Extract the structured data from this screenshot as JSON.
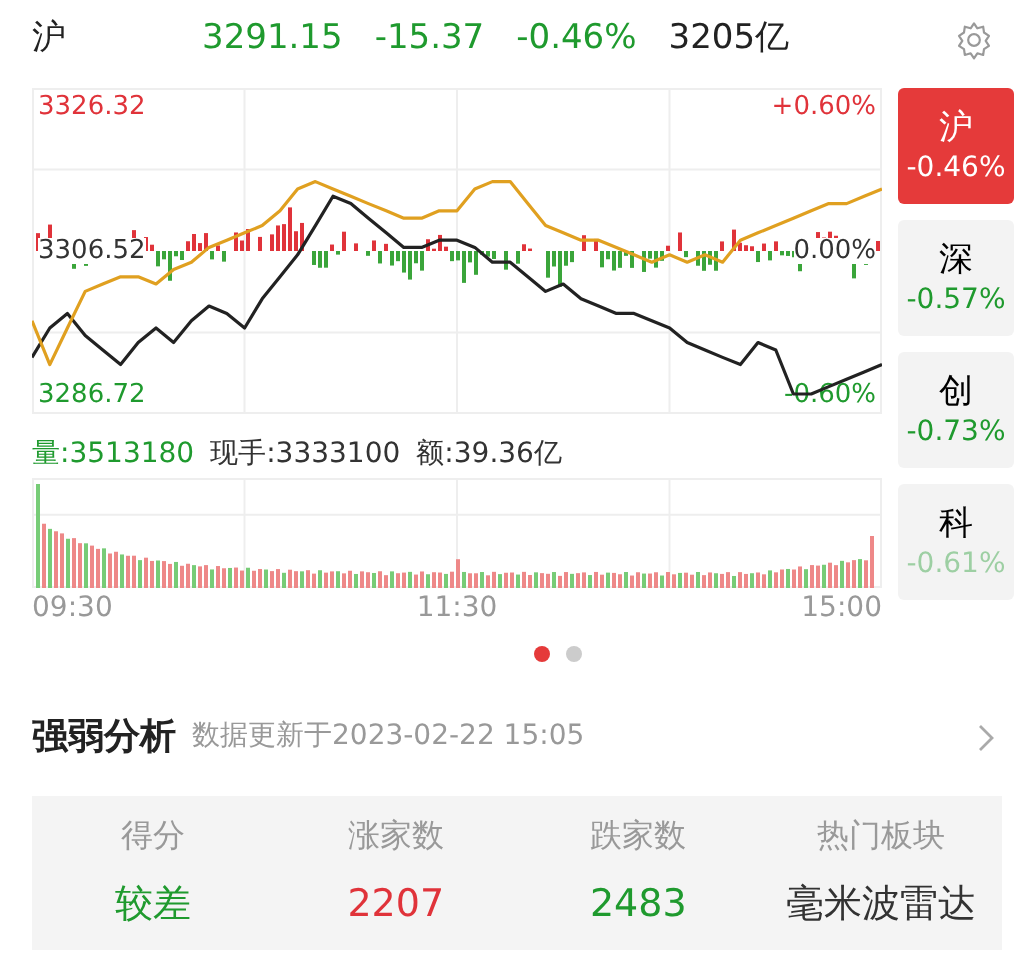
{
  "header": {
    "index_name": "沪",
    "price": "3291.15",
    "change": "-15.37",
    "change_percent": "-0.46%",
    "turnover": "3205亿"
  },
  "chart": {
    "top_percent": "+0.60%",
    "mid_percent": "0.00%",
    "bottom_percent": "-0.60%",
    "chart_data": {
      "type": "line",
      "categories": [
        null,
        null,
        null,
        null,
        null,
        null,
        null,
        null,
        null,
        null,
        null,
        null,
        null,
        null,
        null,
        null,
        null,
        null,
        null,
        null,
        null,
        null,
        null,
        null,
        null,
        null,
        null,
        null,
        null,
        null,
        null,
        null,
        null,
        null,
        null,
        null,
        null,
        null,
        null,
        null,
        null,
        null,
        null,
        null,
        null,
        null,
        null,
        null,
        null
      ],
      "series": [
        {
          "color": "#222222",
          "values": [
            3292,
            3296,
            3298,
            3295,
            3293,
            3291,
            3294,
            3296,
            3294,
            3297,
            3299,
            3298,
            3296,
            3300,
            3303,
            3306,
            3310,
            3314,
            3313,
            3311,
            3309,
            3307,
            3307,
            3308,
            3308,
            3307,
            3305,
            3305,
            3303,
            3301,
            3302,
            3300,
            3299,
            3298,
            3298,
            3297,
            3296,
            3294,
            3293,
            3292,
            3291,
            3294,
            3293,
            3287,
            3287,
            3288,
            3289,
            3290,
            3291
          ]
        },
        {
          "color": "#e0a020",
          "values": [
            3297,
            3291,
            3296,
            3301,
            3302,
            3303,
            3303,
            3302,
            3304,
            3305,
            3307,
            3308,
            3309,
            3310,
            3312,
            3315,
            3316,
            3315,
            3314,
            3313,
            3312,
            3311,
            3311,
            3312,
            3312,
            3315,
            3316,
            3316,
            3313,
            3310,
            3309,
            3308,
            3308,
            3307,
            3306,
            3305,
            3306,
            3305,
            3306,
            3305,
            3308,
            3309,
            3310,
            3311,
            3312,
            3313,
            3313,
            3314,
            3315
          ]
        }
      ],
      "ylim": [
        3284.26,
        3328.78
      ],
      "yticks": [
        {
          "value": 3326.32,
          "label": "3326.32"
        },
        {
          "value": 3306.52,
          "label": "3306.52"
        },
        {
          "value": 3286.72,
          "label": "3286.72"
        }
      ]
    }
  },
  "volume_info": [
    {
      "text": "量:3513180",
      "color": "#1f9a2e"
    },
    {
      "text": "现手:3333100",
      "color": "#333333"
    },
    {
      "text": "额:39.36亿",
      "color": "#333333"
    }
  ],
  "time_axis": [
    "09:30",
    "11:30",
    "15:00"
  ],
  "index_tabs": [
    {
      "label": "沪",
      "change": "-0.46%",
      "selected": true,
      "dimmed": false
    },
    {
      "label": "深",
      "change": "-0.57%",
      "selected": false,
      "dimmed": false
    },
    {
      "label": "创",
      "change": "-0.73%",
      "selected": false,
      "dimmed": false
    },
    {
      "label": "科",
      "change": "-0.61%",
      "selected": false,
      "dimmed": true
    }
  ],
  "pages": [
    {
      "selected": true
    },
    {
      "selected": false
    }
  ],
  "analysis": {
    "title": "强弱分析",
    "updated": "数据更新于2023-02-22 15:05",
    "columns": [
      {
        "header": "得分",
        "value": "较差",
        "color": "#1f9a2e"
      },
      {
        "header": "涨家数",
        "value": "2207",
        "color": "#e0333a"
      },
      {
        "header": "跌家数",
        "value": "2483",
        "color": "#1f9a2e"
      },
      {
        "header": "热门板块",
        "value": "毫米波雷达",
        "color": "#333333"
      }
    ]
  }
}
